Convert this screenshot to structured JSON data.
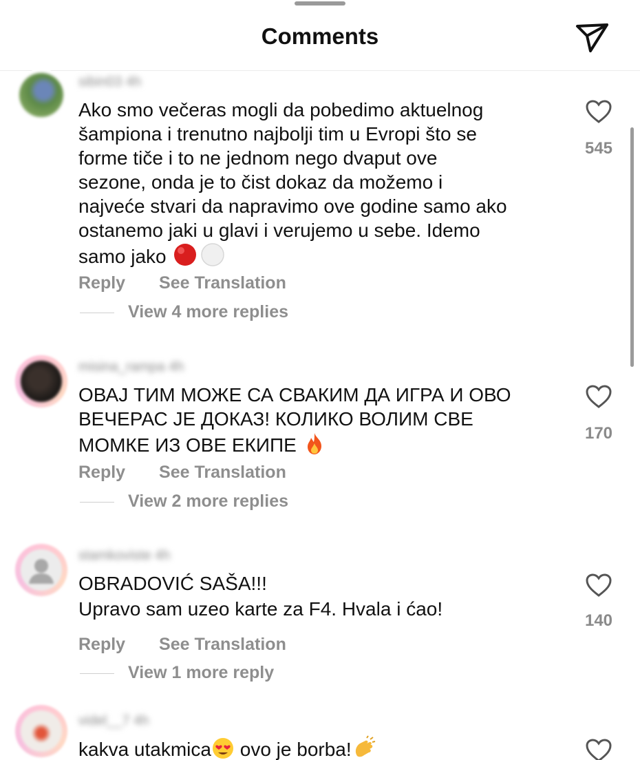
{
  "header": {
    "title": "Comments",
    "share_icon": "send-icon"
  },
  "comments": [
    {
      "username": "sibin03",
      "time": "4h",
      "text_lines": [
        "Ako smo večeras mogli da pobedimo aktuelnog",
        "šampiona i trenutno najbolji tim u Evropi što se",
        "forme tiče i to ne jednom nego dvaput ove",
        "sezone, onda je to čist dokaz da možemo i",
        "najveće stvari da napravimo ove godine samo ako",
        "ostanemo jaki u glavi i verujemo u sebe. Idemo",
        "samo jako"
      ],
      "reply": "Reply",
      "translate": "See Translation",
      "more_replies": "View 4 more replies",
      "likes": "545"
    },
    {
      "username": "misina_rampa",
      "time": "4h",
      "text_lines": [
        "ОВАЈ ТИМ МОЖЕ СА СВАКИМ ДА ИГРА И ОВО",
        "ВЕЧЕРАС ЈЕ ДОКАЗ! КОЛИКО ВОЛИМ СВЕ",
        "МОМКЕ ИЗ ОВЕ ЕКИПЕ"
      ],
      "reply": "Reply",
      "translate": "See Translation",
      "more_replies": "View 2 more replies",
      "likes": "170"
    },
    {
      "username": "stamkoviste",
      "time": "4h",
      "text_lines": [
        "OBRADOVIĆ SAŠA!!!",
        "Upravo sam uzeo karte za F4. Hvala i ćao!"
      ],
      "reply": "Reply",
      "translate": "See Translation",
      "more_replies": "View 1 more reply",
      "likes": "140"
    },
    {
      "username": "videl__7",
      "time": "4h",
      "text_lines": [
        "kakva utakmica",
        " ovo je borba!"
      ]
    }
  ],
  "colors": {
    "accent_text": "#8e8e8e",
    "ring": "#ffc6d6"
  }
}
